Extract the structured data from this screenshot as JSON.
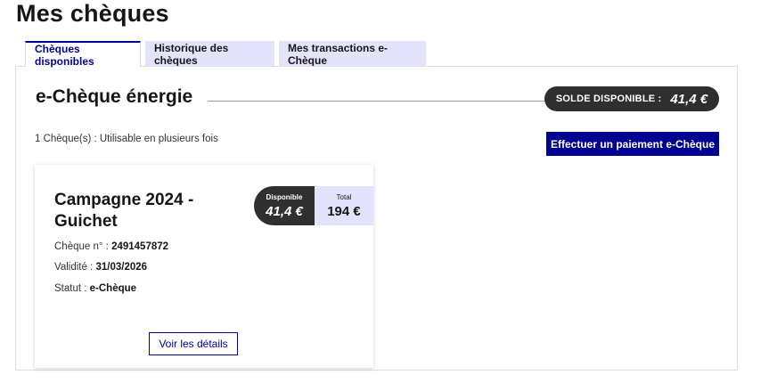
{
  "page": {
    "title": "Mes chèques"
  },
  "tabs": [
    {
      "label": "Chèques disponibles",
      "active": true
    },
    {
      "label": "Historique des chèques",
      "active": false
    },
    {
      "label": "Mes transactions e-Chèque",
      "active": false
    }
  ],
  "section": {
    "title": "e-Chèque énergie",
    "balance_label": "SOLDE DISPONIBLE :",
    "balance_value": "41,4 €",
    "usage_text": "1 Chèque(s) : Utilisable en plusieurs fois",
    "pay_button": "Effectuer un paiement e-Chèque"
  },
  "card": {
    "title": "Campagne 2024 - Guichet",
    "available_label": "Disponible",
    "available_value": "41,4 €",
    "total_label": "Total",
    "total_value": "194 €",
    "cheque_label": "Chèque n° :",
    "cheque_number": "2491457872",
    "validity_label": "Validité :",
    "validity_value": "31/03/2026",
    "status_label": "Statut :",
    "status_value": "e-Chèque",
    "details_button": "Voir les détails"
  },
  "colors": {
    "primary": "#000091",
    "tab_inactive": "#e3e3fd",
    "pill_dark": "#2f2f2f"
  }
}
